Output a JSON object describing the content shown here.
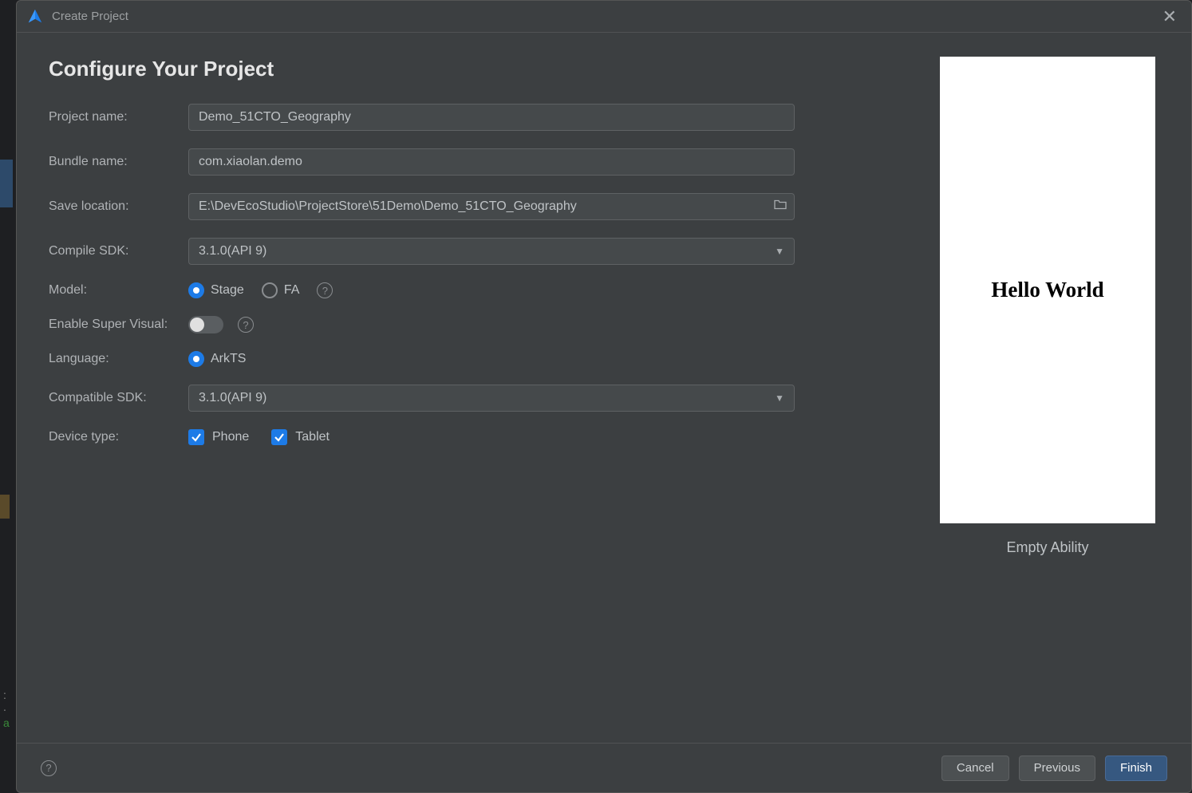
{
  "titlebar": {
    "title": "Create Project"
  },
  "page": {
    "heading": "Configure Your Project"
  },
  "form": {
    "project_name": {
      "label": "Project name:",
      "value": "Demo_51CTO_Geography"
    },
    "bundle_name": {
      "label": "Bundle name:",
      "value": "com.xiaolan.demo"
    },
    "save_location": {
      "label": "Save location:",
      "value": "E:\\DevEcoStudio\\ProjectStore\\51Demo\\Demo_51CTO_Geography"
    },
    "compile_sdk": {
      "label": "Compile SDK:",
      "value": "3.1.0(API 9)"
    },
    "model": {
      "label": "Model:",
      "options": [
        "Stage",
        "FA"
      ],
      "selected": "Stage"
    },
    "enable_super_visual": {
      "label": "Enable Super Visual:",
      "value": false
    },
    "language": {
      "label": "Language:",
      "options": [
        "ArkTS"
      ],
      "selected": "ArkTS"
    },
    "compatible_sdk": {
      "label": "Compatible SDK:",
      "value": "3.1.0(API 9)"
    },
    "device_type": {
      "label": "Device type:",
      "options": [
        {
          "name": "Phone",
          "checked": true
        },
        {
          "name": "Tablet",
          "checked": true
        }
      ]
    }
  },
  "preview": {
    "text": "Hello World",
    "caption": "Empty Ability"
  },
  "footer": {
    "cancel": "Cancel",
    "previous": "Previous",
    "finish": "Finish"
  }
}
